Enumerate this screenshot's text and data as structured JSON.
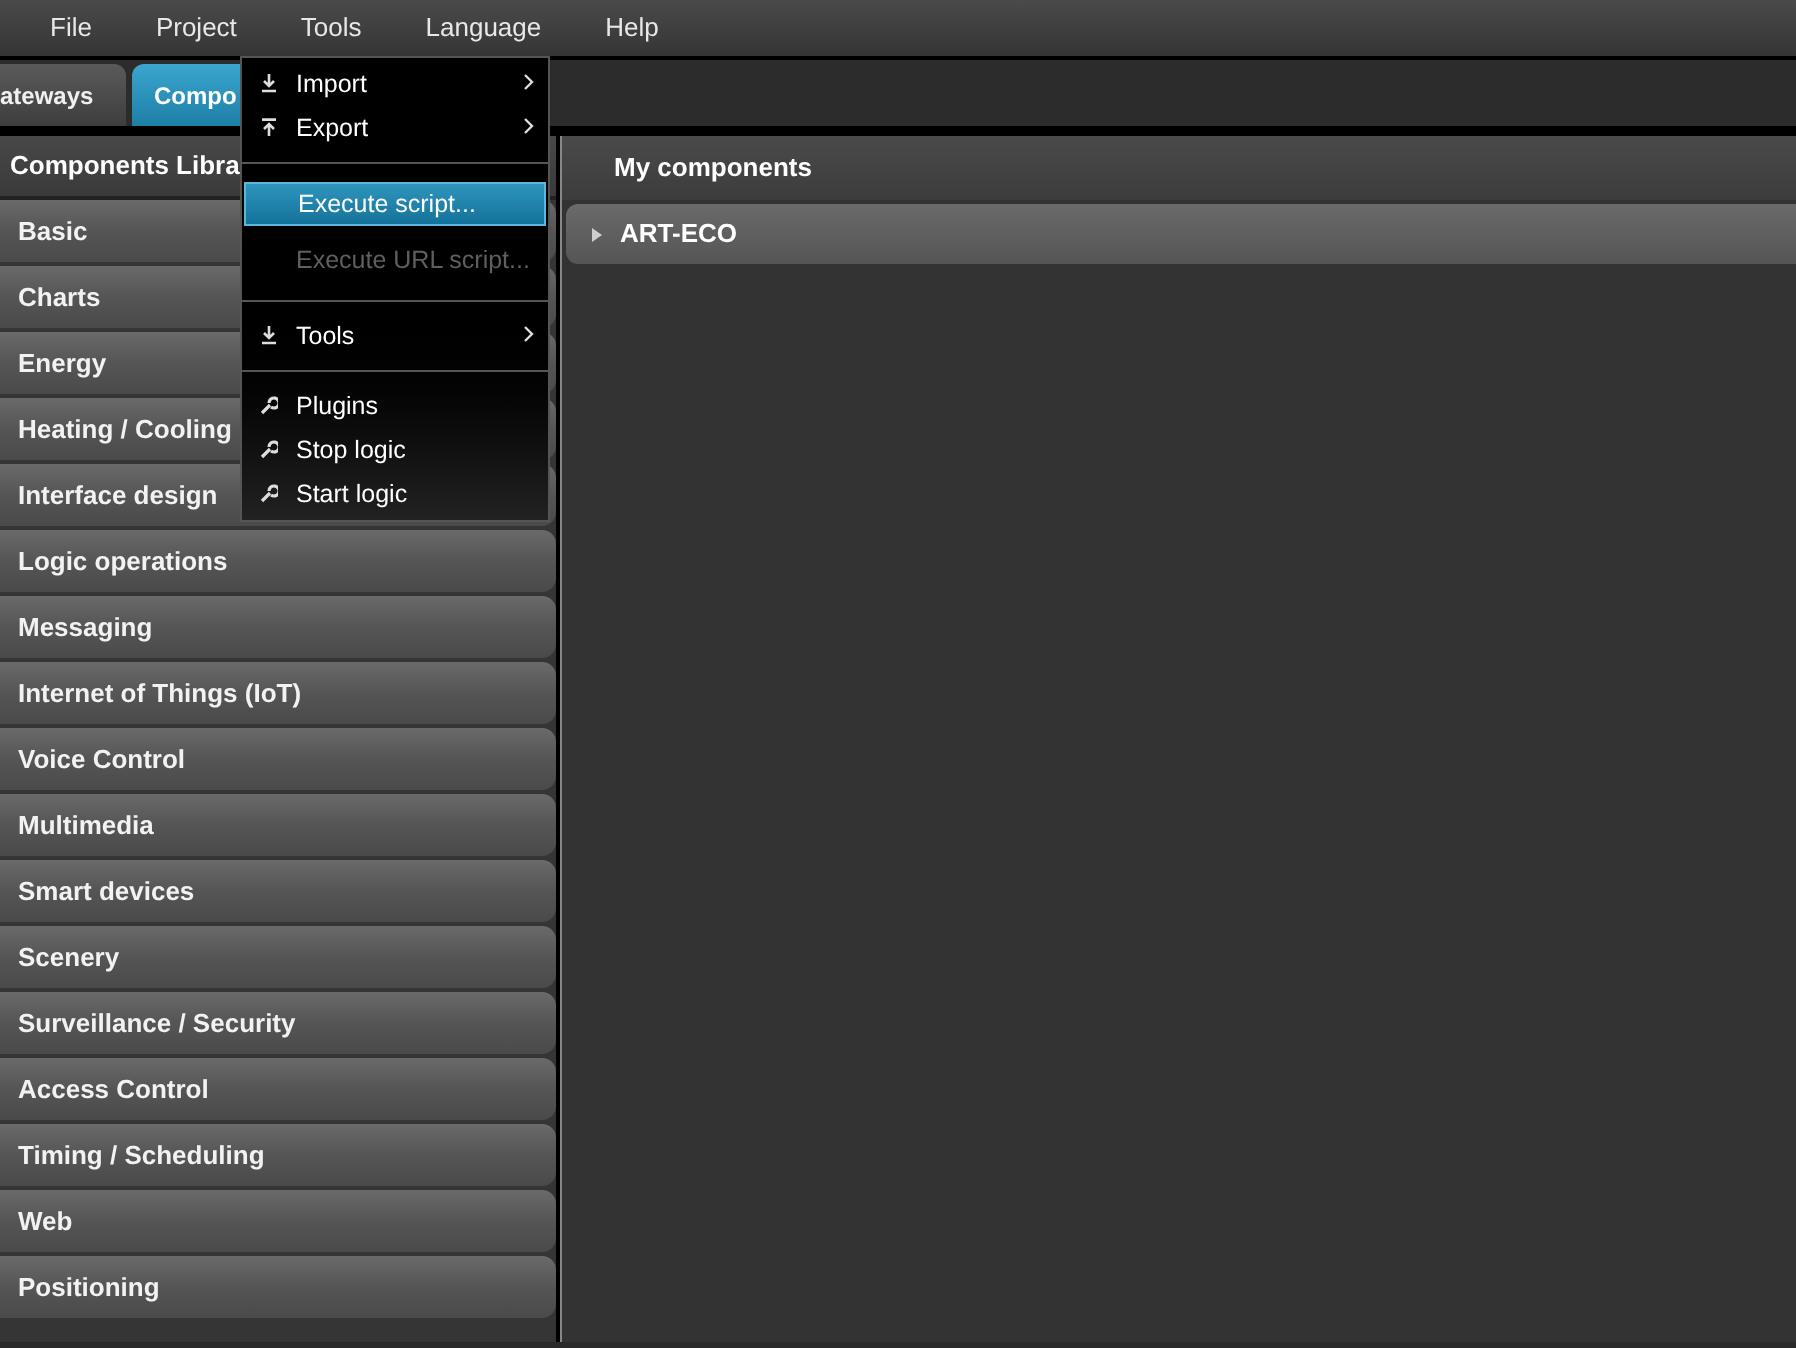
{
  "menu_bar": [
    {
      "label": "File"
    },
    {
      "label": "Project"
    },
    {
      "label": "Tools"
    },
    {
      "label": "Language"
    },
    {
      "label": "Help"
    }
  ],
  "tabs": [
    {
      "label": "ateways",
      "selected": false
    },
    {
      "label": "Compo",
      "selected": true
    }
  ],
  "tools_menu": [
    {
      "kind": "item",
      "label": "Import",
      "submenu": true,
      "selected": false,
      "disabled": false
    },
    {
      "kind": "item",
      "label": "Export",
      "submenu": true,
      "selected": false,
      "disabled": false
    },
    {
      "kind": "separator"
    },
    {
      "kind": "item",
      "label": "Execute script...",
      "submenu": false,
      "selected": true,
      "disabled": false
    },
    {
      "kind": "item",
      "label": "Execute URL script...",
      "submenu": false,
      "selected": false,
      "disabled": true
    },
    {
      "kind": "separator"
    },
    {
      "kind": "item",
      "label": "Tools",
      "submenu": true,
      "selected": false,
      "disabled": false
    },
    {
      "kind": "separator"
    },
    {
      "kind": "item",
      "label": "Plugins",
      "submenu": false,
      "selected": false,
      "disabled": false
    },
    {
      "kind": "item",
      "label": "Stop logic",
      "submenu": false,
      "selected": false,
      "disabled": false
    },
    {
      "kind": "item",
      "label": "Start logic",
      "submenu": false,
      "selected": false,
      "disabled": false
    }
  ],
  "library": {
    "title": "Components Libra",
    "categories": [
      "Basic",
      "Charts",
      "Energy",
      "Heating / Cooling",
      "Interface design",
      "Logic operations",
      "Messaging",
      "Internet of Things (IoT)",
      "Voice Control",
      "Multimedia",
      "Smart devices",
      "Scenery",
      "Surveillance / Security",
      "Access Control",
      "Timing / Scheduling",
      "Web",
      "Positioning"
    ]
  },
  "my_components": {
    "title": "My components",
    "groups": [
      {
        "label": "ART-ECO",
        "expanded": false
      }
    ]
  }
}
